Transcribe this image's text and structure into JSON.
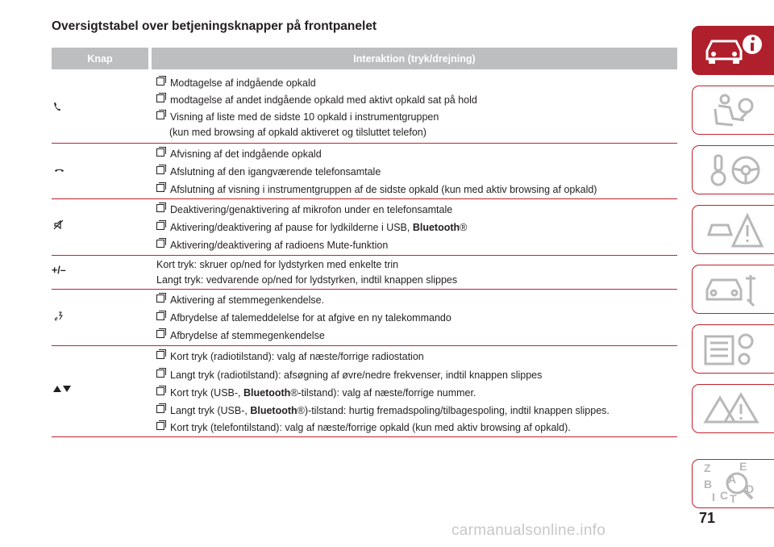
{
  "page": {
    "title": "Oversigtstabel over betjeningsknapper på frontpanelet",
    "page_number": "71",
    "watermark": "carmanualsonline.info"
  },
  "table": {
    "headers": [
      "Knap",
      "Interaktion (tryk/drejning)"
    ],
    "rows": [
      {
        "knap_icon": "phone-answer-icon",
        "items": [
          "Modtagelse af indgående opkald",
          "modtagelse af andet indgående opkald med aktivt opkald sat på hold",
          "Visning af liste med de sidste 10 opkald i instrumentgruppen",
          "(kun med browsing af opkald aktiveret og tilsluttet telefon)"
        ]
      },
      {
        "knap_icon": "phone-hangup-icon",
        "items": [
          "Afvisning af det indgående opkald",
          "Afslutning af den igangværende telefonsamtale",
          "Afslutning af visning i instrumentgruppen af de sidste opkald (kun med aktiv browsing af opkald)"
        ]
      },
      {
        "knap_icon": "mute-icon",
        "items": [
          "Deaktivering/genaktivering af mikrofon under en telefonsamtale",
          "Aktivering/deaktivering af pause for lydkilderne i USB, ",
          "Bluetooth",
          "®",
          "Aktivering/deaktivering af radioens Mute-funktion"
        ]
      },
      {
        "knap_text": "+/–",
        "items": [
          "Kort tryk: skruer op/ned for lydstyrken med enkelte trin",
          "Langt tryk: vedvarende op/ned for lydstyrken, indtil knappen slippes"
        ]
      },
      {
        "knap_icon": "voice-command-icon",
        "items": [
          "Aktivering af stemmegenkendelse.",
          "Afbrydelse af talemeddelelse for at afgive en ny talekommando",
          "Afbrydelse af stemmegenkendelse"
        ]
      },
      {
        "knap_icon": "up-down-arrows-icon",
        "items": [
          "Kort tryk (radiotilstand): valg af næste/forrige radiostation",
          "Langt tryk (radiotilstand): afsøgning af øvre/nedre frekvenser, indtil knappen slippes",
          "Kort tryk (USB-, ",
          "Bluetooth",
          "®-tilstand): valg af næste/forrige nummer.",
          "Langt tryk (USB-, ",
          "Bluetooth",
          "®)-tilstand: hurtig fremadspoling/tilbagespoling, indtil knappen slippes.",
          "Kort tryk (telefontilstand): valg af næste/forrige opkald (kun med aktiv browsing af opkald)."
        ]
      }
    ]
  },
  "sidebar": {
    "tabs": [
      {
        "icon": "car-info-icon",
        "active": true
      },
      {
        "icon": "airbag-seat-icon",
        "active": false
      },
      {
        "icon": "key-steering-wheel-icon",
        "active": false
      },
      {
        "icon": "accident-warning-icon",
        "active": false
      },
      {
        "icon": "car-maintenance-icon",
        "active": false
      },
      {
        "icon": "specifications-gears-icon",
        "active": false
      },
      {
        "icon": "multimedia-warning-icon",
        "active": false
      },
      {
        "icon": "alphabetical-index-icon",
        "active": false
      }
    ],
    "index_letters": [
      "Z",
      "E",
      "B",
      "C",
      "A",
      "I",
      "T",
      "D"
    ]
  },
  "colors": {
    "accent": "#b01f2c",
    "header_bg": "#bcbec0",
    "text": "#231f20"
  }
}
